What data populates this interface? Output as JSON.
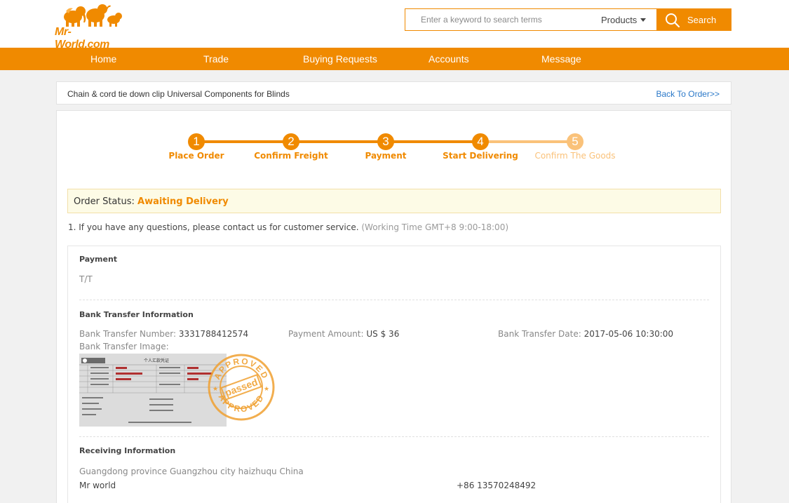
{
  "header": {
    "logo_text": "Mr-World.com",
    "search_placeholder": "Enter a keyword to search terms",
    "category_select": "Products",
    "search_button": "Search"
  },
  "nav": {
    "items": [
      {
        "label": "Home"
      },
      {
        "label": "Trade"
      },
      {
        "label": "Buying Requests"
      },
      {
        "label": "Accounts"
      },
      {
        "label": "Message"
      }
    ]
  },
  "product_bar": {
    "title": "Chain & cord tie down clip Universal Components for Blinds",
    "back_link": "Back To Order>>"
  },
  "progress": {
    "current_step": 4,
    "steps": [
      {
        "number": "1",
        "label": "Place Order"
      },
      {
        "number": "2",
        "label": "Confirm Freight"
      },
      {
        "number": "3",
        "label": "Payment"
      },
      {
        "number": "4",
        "label": "Start Delivering"
      },
      {
        "number": "5",
        "label": "Confirm The Goods"
      }
    ]
  },
  "order_status": {
    "label": "Order Status:",
    "value": "Awaiting Delivery"
  },
  "notice": {
    "text": "1. If you have any questions, please contact us for customer service.",
    "sub": "(Working Time GMT+8 9:00-18:00)"
  },
  "payment": {
    "title": "Payment",
    "method": "T/T"
  },
  "bank_transfer": {
    "title": "Bank Transfer Information",
    "number_label": "Bank Transfer Number:",
    "number_value": "3331788412574",
    "amount_label": "Payment Amount:",
    "amount_value": "US $ 36",
    "date_label": "Bank Transfer Date:",
    "date_value": "2017-05-06 10:30:00",
    "image_label": "Bank Transfer Image:",
    "receipt_title": "个人汇款凭证",
    "stamp_top": "APPROVED",
    "stamp_middle": "passed",
    "stamp_bottom": "APPROVED"
  },
  "receiving": {
    "title": "Receiving Information",
    "address": "Guangdong province Guangzhou city haizhuqu China",
    "name": "Mr world",
    "phone": "+86 13570248492"
  },
  "colors": {
    "brand": "#f08a00",
    "step_pending": "#fac27a",
    "link": "#2a78c8"
  }
}
